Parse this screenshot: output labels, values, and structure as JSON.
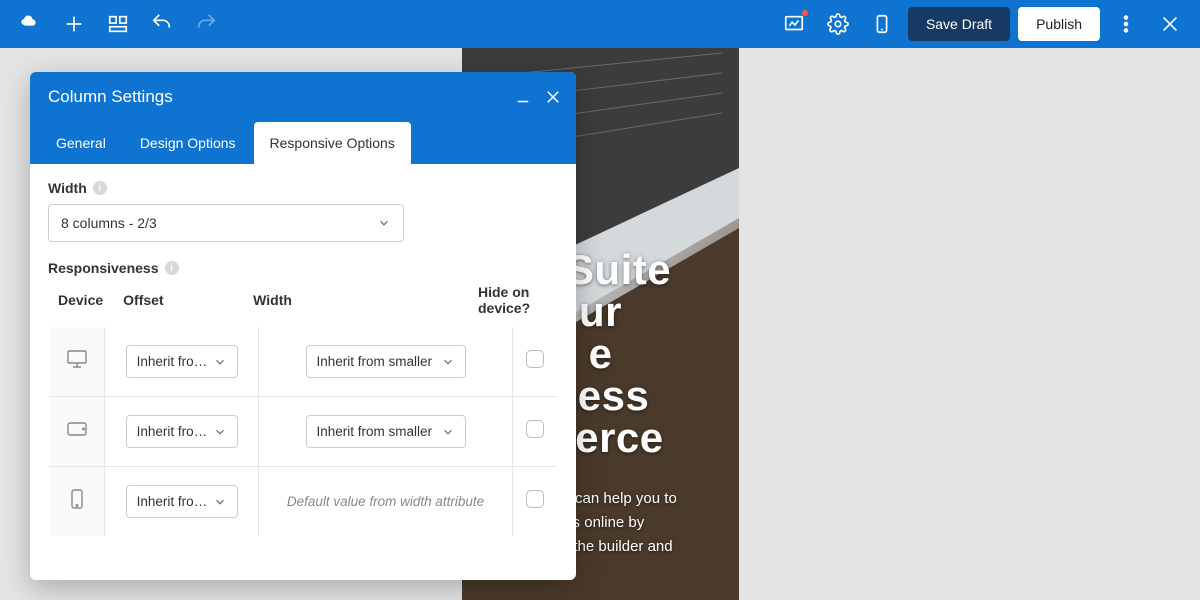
{
  "topbar": {
    "save_label": "Save Draft",
    "publish_label": "Publish"
  },
  "panel": {
    "title": "Column Settings",
    "tabs": {
      "general": "General",
      "design": "Design Options",
      "responsive": "Responsive Options"
    },
    "width_label": "Width",
    "width_value": "8 columns - 2/3",
    "responsiveness_label": "Responsiveness",
    "cols": {
      "device": "Device",
      "offset": "Offset",
      "width": "Width",
      "hide": "Hide on device?"
    },
    "offset_opt": "Inherit from sm",
    "width_opt": "Inherit from smaller",
    "default_note": "Default value from width attribute"
  },
  "hero": {
    "title": "e Suite\nur\ne\nness\nmerce",
    "desc": "Builder can help you to\ness online by\nwer of the builder and"
  }
}
